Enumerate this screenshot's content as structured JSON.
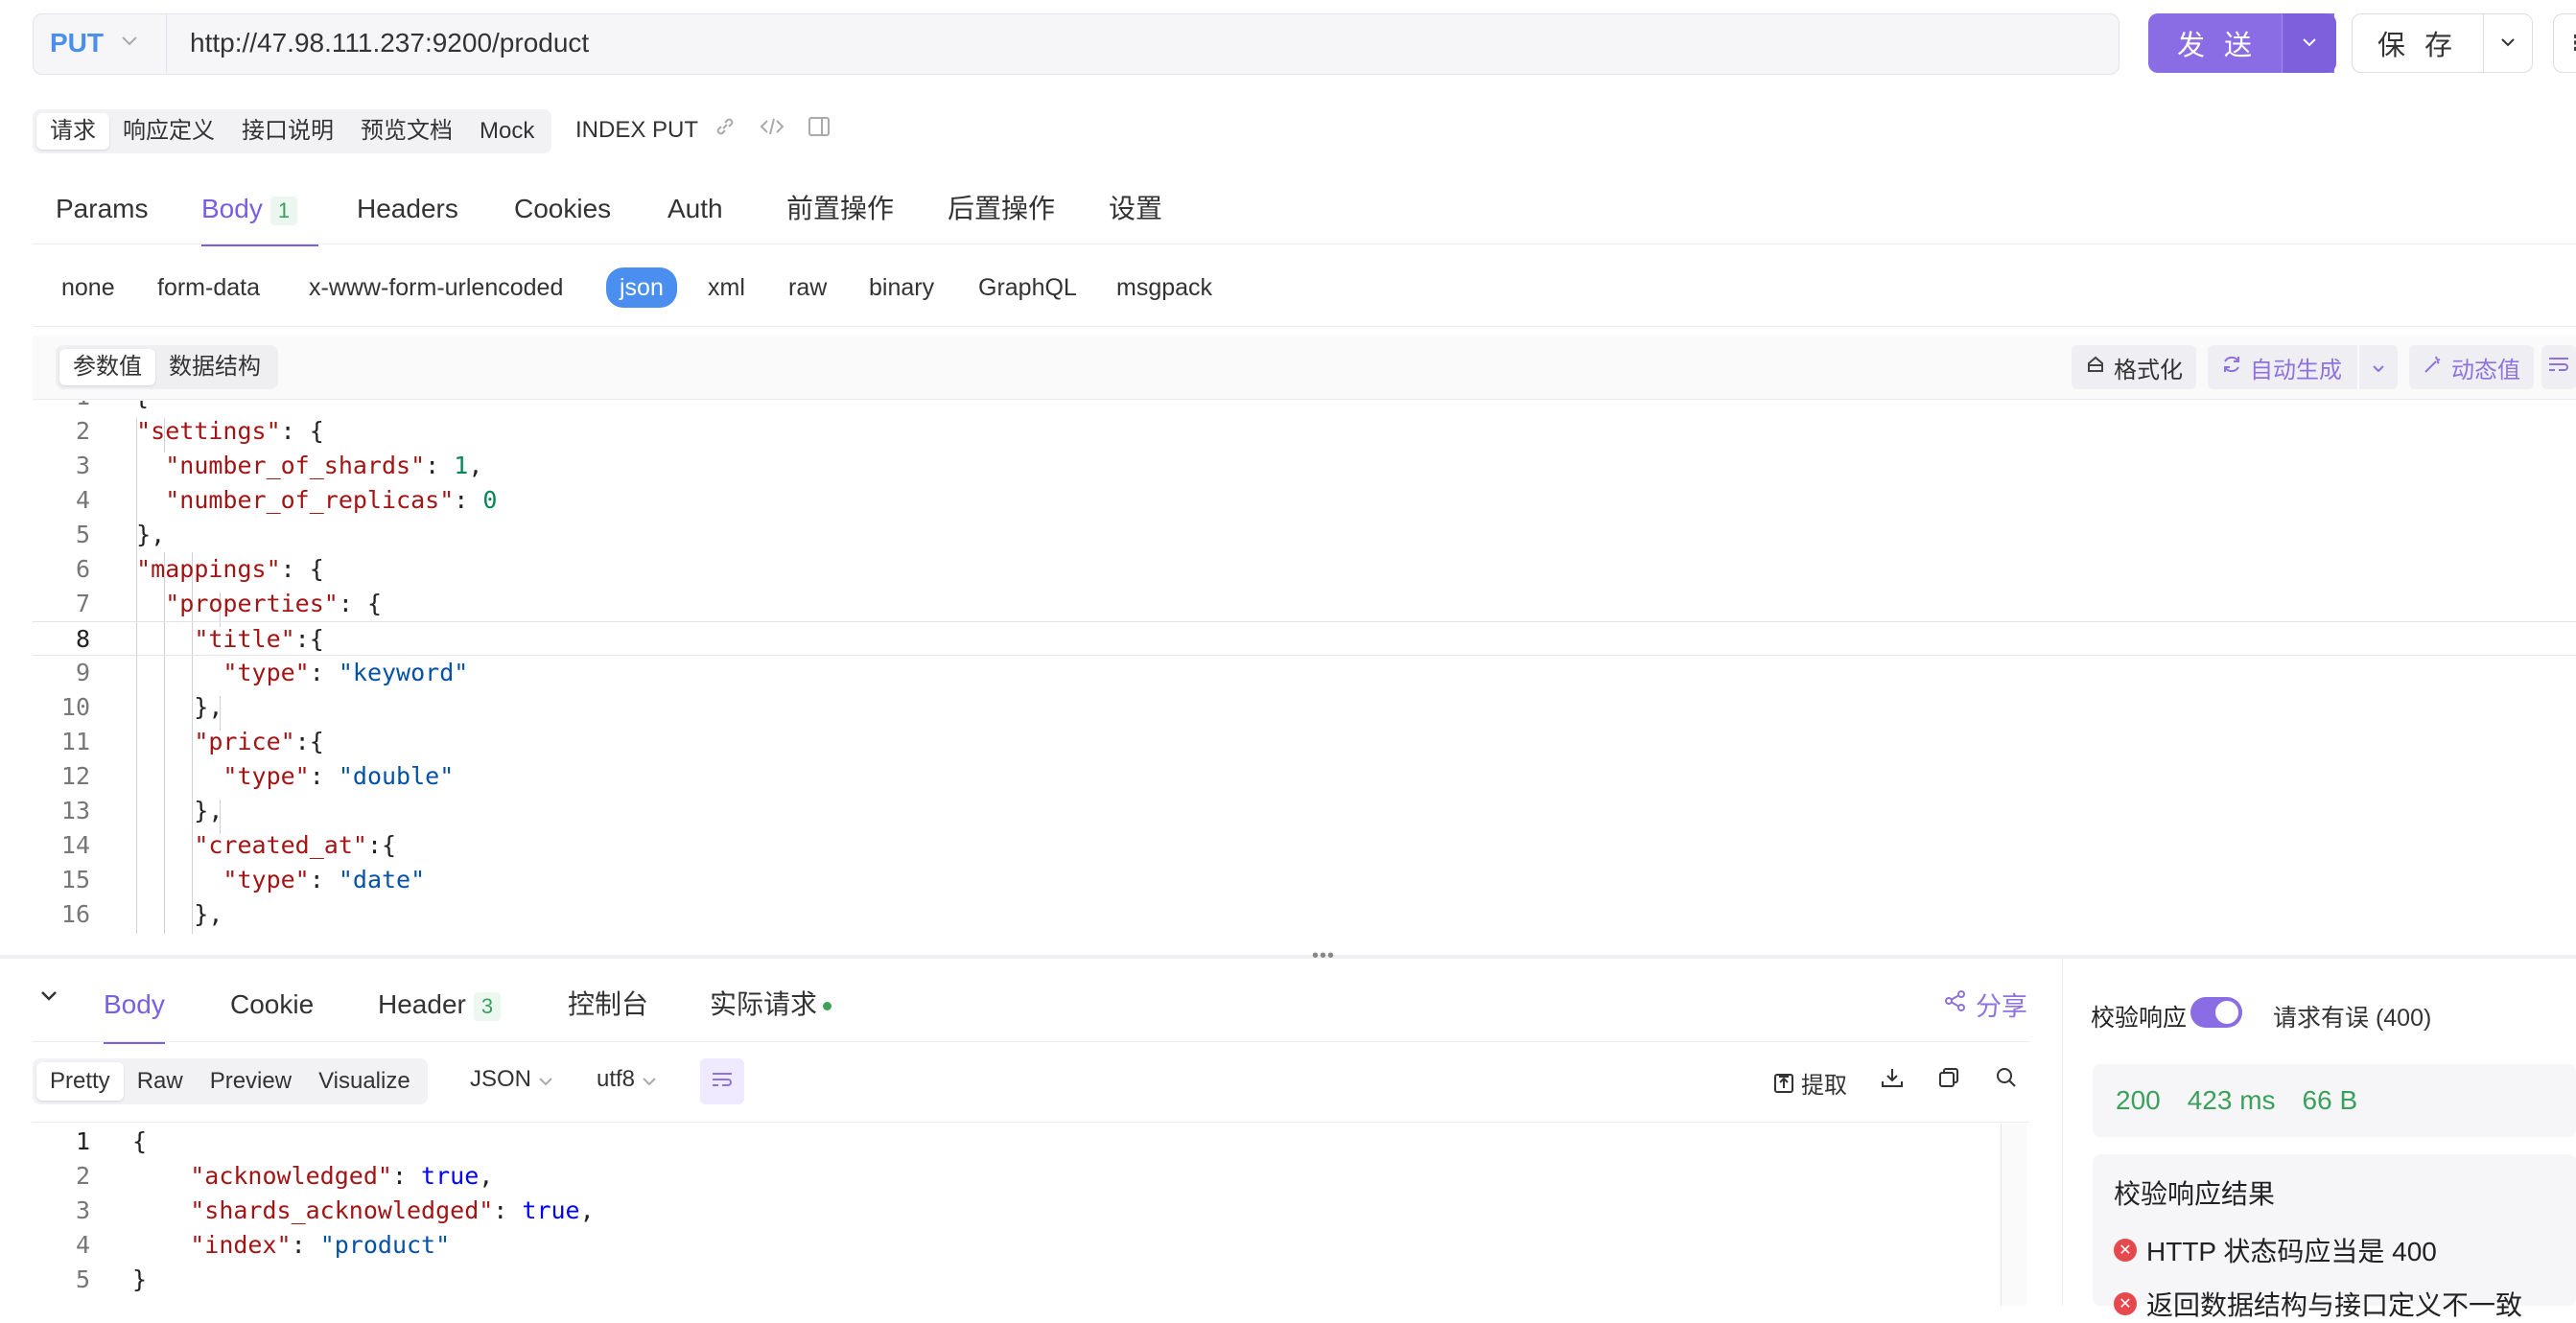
{
  "request": {
    "method": "PUT",
    "url": "http://47.98.111.237:9200/product",
    "send_label": "发 送",
    "save_label": "保 存"
  },
  "sub_tabs": [
    "请求",
    "响应定义",
    "接口说明",
    "预览文档",
    "Mock"
  ],
  "endpoint_name": "INDEX PUT",
  "main_tabs": {
    "params": "Params",
    "body": "Body",
    "body_count": "1",
    "headers": "Headers",
    "cookies": "Cookies",
    "auth": "Auth",
    "pre": "前置操作",
    "post": "后置操作",
    "settings": "设置"
  },
  "body_types": [
    "none",
    "form-data",
    "x-www-form-urlencoded",
    "json",
    "xml",
    "raw",
    "binary",
    "GraphQL",
    "msgpack"
  ],
  "body_type_selected": "json",
  "editor_tabs": [
    "参数值",
    "数据结构"
  ],
  "editor_tools": {
    "format": "格式化",
    "autogen": "自动生成",
    "dynamic": "动态值"
  },
  "request_body_lines": [
    {
      "n": "2",
      "t": "  \"settings\": {"
    },
    {
      "n": "3",
      "t": "    \"number_of_shards\": 1,"
    },
    {
      "n": "4",
      "t": "    \"number_of_replicas\": 0"
    },
    {
      "n": "5",
      "t": "  },"
    },
    {
      "n": "6",
      "t": "  \"mappings\": {"
    },
    {
      "n": "7",
      "t": "    \"properties\": {"
    },
    {
      "n": "8",
      "t": "      \"title\":{"
    },
    {
      "n": "9",
      "t": "        \"type\": \"keyword\""
    },
    {
      "n": "10",
      "t": "      },"
    },
    {
      "n": "11",
      "t": "      \"price\":{"
    },
    {
      "n": "12",
      "t": "        \"type\": \"double\""
    },
    {
      "n": "13",
      "t": "      },"
    },
    {
      "n": "14",
      "t": "      \"created_at\":{"
    },
    {
      "n": "15",
      "t": "        \"type\": \"date\""
    },
    {
      "n": "16",
      "t": "      },"
    }
  ],
  "response_tabs": {
    "body": "Body",
    "cookie": "Cookie",
    "header": "Header",
    "header_count": "3",
    "console": "控制台",
    "actual": "实际请求",
    "share": "分享"
  },
  "response_formats": [
    "Pretty",
    "Raw",
    "Preview",
    "Visualize"
  ],
  "response_lang": "JSON",
  "response_encoding": "utf8",
  "response_tools": {
    "extract": "提取"
  },
  "response_body_lines": [
    {
      "n": "1",
      "t": "{"
    },
    {
      "n": "2",
      "t": "    \"acknowledged\": true,"
    },
    {
      "n": "3",
      "t": "    \"shards_acknowledged\": true,"
    },
    {
      "n": "4",
      "t": "    \"index\": \"product\""
    },
    {
      "n": "5",
      "t": "}"
    }
  ],
  "verify": {
    "label": "校验响应",
    "enabled": true,
    "request_status": "请求有误 (400)",
    "status_code": "200",
    "time": "423 ms",
    "size": "66 B",
    "result_title": "校验响应结果",
    "results": [
      "HTTP 状态码应当是 400",
      "返回数据结构与接口定义不一致"
    ]
  },
  "colors": {
    "accent": "#8a6ce4",
    "method": "#4a8ef0",
    "success": "#3aa05a",
    "error": "#e5484d"
  }
}
